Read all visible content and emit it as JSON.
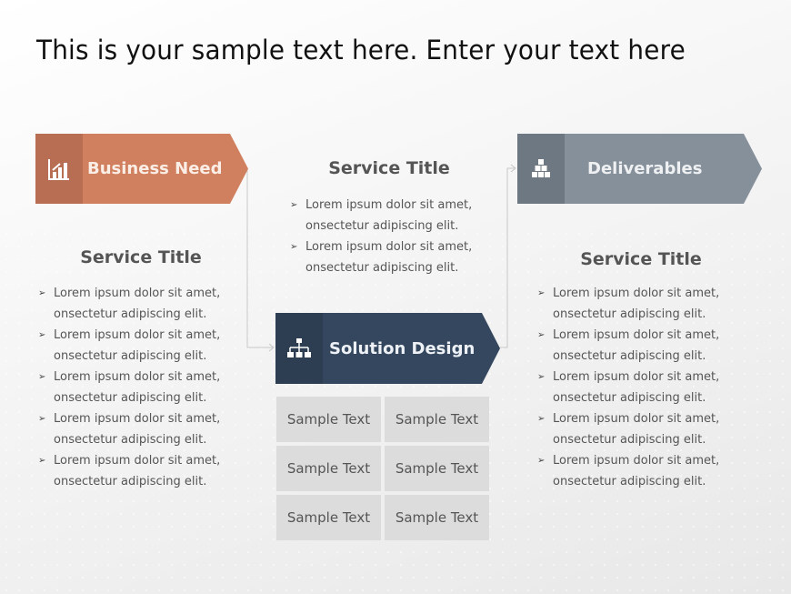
{
  "slide": {
    "title": "This is your sample text here. Enter your text here"
  },
  "banners": {
    "business_need": {
      "label": "Business Need",
      "icon": "bar-chart-icon",
      "color": "#D0805F",
      "icon_color": "#B86E52"
    },
    "solution_design": {
      "label": "Solution Design",
      "icon": "org-chart-icon",
      "color": "#34475E",
      "icon_color": "#2D3E52"
    },
    "deliverables": {
      "label": "Deliverables",
      "icon": "stacked-boxes-icon",
      "color": "#86909B",
      "icon_color": "#6E7882"
    }
  },
  "sections": {
    "left": {
      "title": "Service Title",
      "bullets": [
        "Lorem ipsum dolor sit amet, onsectetur adipiscing elit.",
        "Lorem ipsum dolor sit amet, onsectetur adipiscing elit.",
        "Lorem ipsum dolor sit amet, onsectetur adipiscing elit.",
        "Lorem ipsum dolor sit amet, onsectetur adipiscing elit.",
        "Lorem ipsum dolor sit amet, onsectetur adipiscing elit."
      ]
    },
    "middle": {
      "title": "Service Title",
      "bullets": [
        "Lorem ipsum dolor sit amet, onsectetur adipiscing elit.",
        "Lorem ipsum dolor sit amet, onsectetur adipiscing elit."
      ]
    },
    "right": {
      "title": "Service Title",
      "bullets": [
        "Lorem ipsum dolor sit amet, onsectetur adipiscing elit.",
        "Lorem ipsum dolor sit amet, onsectetur adipiscing elit.",
        "Lorem ipsum dolor sit amet, onsectetur adipiscing elit.",
        "Lorem ipsum dolor sit amet, onsectetur adipiscing elit.",
        "Lorem ipsum dolor sit amet, onsectetur adipiscing elit."
      ]
    }
  },
  "grid": {
    "cells": [
      "Sample Text",
      "Sample Text",
      "Sample Text",
      "Sample Text",
      "Sample Text",
      "Sample Text"
    ]
  },
  "bullet_glyph": "➢"
}
